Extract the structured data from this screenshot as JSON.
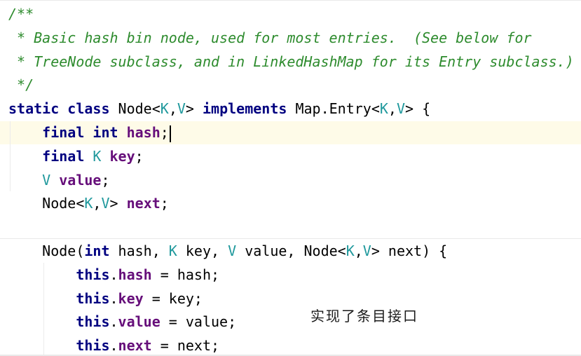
{
  "editor": {
    "lines": [
      [
        {
          "t": "/**",
          "c": "c"
        }
      ],
      [
        {
          "t": " * Basic hash bin node, used for most entries.  (See below for",
          "c": "c"
        }
      ],
      [
        {
          "t": " * TreeNode subclass, and in LinkedHashMap for its Entry subclass.)",
          "c": "c"
        }
      ],
      [
        {
          "t": " */",
          "c": "c"
        }
      ],
      [
        {
          "t": "static class ",
          "c": "kw"
        },
        {
          "t": "Node<",
          "c": "tx"
        },
        {
          "t": "K",
          "c": "tp"
        },
        {
          "t": ",",
          "c": "tx"
        },
        {
          "t": "V",
          "c": "tp"
        },
        {
          "t": "> ",
          "c": "tx"
        },
        {
          "t": "implements ",
          "c": "kw"
        },
        {
          "t": "Map.Entry<",
          "c": "tx"
        },
        {
          "t": "K",
          "c": "tp"
        },
        {
          "t": ",",
          "c": "tx"
        },
        {
          "t": "V",
          "c": "tp"
        },
        {
          "t": "> {",
          "c": "tx"
        }
      ],
      [
        {
          "t": "    ",
          "c": "tx"
        },
        {
          "t": "final int ",
          "c": "kw"
        },
        {
          "t": "hash",
          "c": "fd"
        },
        {
          "t": ";",
          "c": "tx"
        }
      ],
      [
        {
          "t": "    ",
          "c": "tx"
        },
        {
          "t": "final ",
          "c": "kw"
        },
        {
          "t": "K ",
          "c": "tp"
        },
        {
          "t": "key",
          "c": "fd"
        },
        {
          "t": ";",
          "c": "tx"
        }
      ],
      [
        {
          "t": "    ",
          "c": "tx"
        },
        {
          "t": "V ",
          "c": "tp"
        },
        {
          "t": "value",
          "c": "fd"
        },
        {
          "t": ";",
          "c": "tx"
        }
      ],
      [
        {
          "t": "    Node<",
          "c": "tx"
        },
        {
          "t": "K",
          "c": "tp"
        },
        {
          "t": ",",
          "c": "tx"
        },
        {
          "t": "V",
          "c": "tp"
        },
        {
          "t": "> ",
          "c": "tx"
        },
        {
          "t": "next",
          "c": "fd"
        },
        {
          "t": ";",
          "c": "tx"
        }
      ],
      [],
      [
        {
          "t": "    Node(",
          "c": "tx"
        },
        {
          "t": "int ",
          "c": "kw"
        },
        {
          "t": "hash, ",
          "c": "tx"
        },
        {
          "t": "K ",
          "c": "tp"
        },
        {
          "t": "key, ",
          "c": "tx"
        },
        {
          "t": "V ",
          "c": "tp"
        },
        {
          "t": "value, Node<",
          "c": "tx"
        },
        {
          "t": "K",
          "c": "tp"
        },
        {
          "t": ",",
          "c": "tx"
        },
        {
          "t": "V",
          "c": "tp"
        },
        {
          "t": "> next) {",
          "c": "tx"
        }
      ],
      [
        {
          "t": "        ",
          "c": "tx"
        },
        {
          "t": "this",
          "c": "kw"
        },
        {
          "t": ".",
          "c": "tx"
        },
        {
          "t": "hash",
          "c": "fd"
        },
        {
          "t": " = hash;",
          "c": "tx"
        }
      ],
      [
        {
          "t": "        ",
          "c": "tx"
        },
        {
          "t": "this",
          "c": "kw"
        },
        {
          "t": ".",
          "c": "tx"
        },
        {
          "t": "key",
          "c": "fd"
        },
        {
          "t": " = key;",
          "c": "tx"
        }
      ],
      [
        {
          "t": "        ",
          "c": "tx"
        },
        {
          "t": "this",
          "c": "kw"
        },
        {
          "t": ".",
          "c": "tx"
        },
        {
          "t": "value",
          "c": "fd"
        },
        {
          "t": " = value;",
          "c": "tx"
        }
      ],
      [
        {
          "t": "        ",
          "c": "tx"
        },
        {
          "t": "this",
          "c": "kw"
        },
        {
          "t": ".",
          "c": "tx"
        },
        {
          "t": "next",
          "c": "fd"
        },
        {
          "t": " = next;",
          "c": "tx"
        }
      ]
    ],
    "caret_line": 5,
    "annotation": "实现了条目接口",
    "colors": {
      "comment": "#2d8b2d",
      "keyword": "#000080",
      "type_param": "#20999d",
      "field": "#660e7a",
      "text": "#000000",
      "caret_row": "#fefbe8",
      "background": "#ffffff"
    }
  }
}
